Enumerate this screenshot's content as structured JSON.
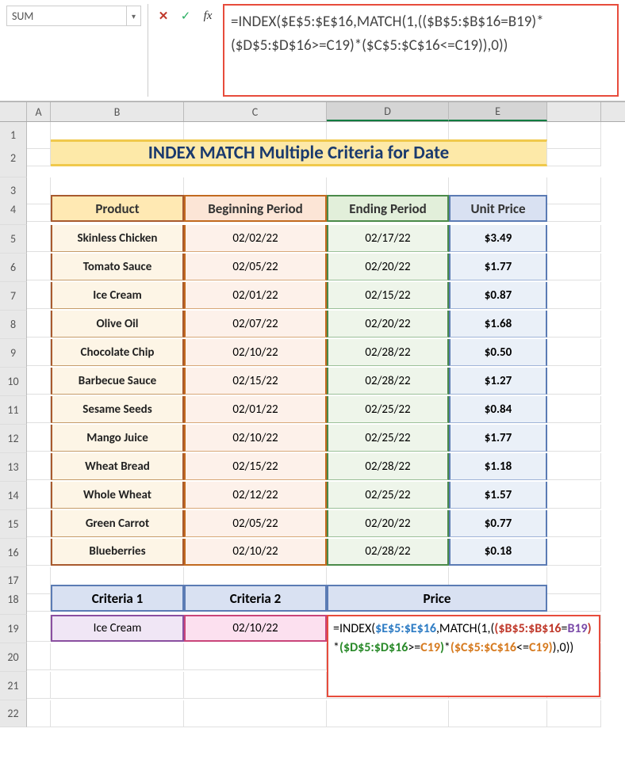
{
  "namebox": "SUM",
  "formula_bar": "=INDEX($E$5:$E$16,MATCH(1,(($B$5:$B$16=B19)*($D$5:$D$16>=C19)*($C$5:$C$16<=C19)),0))",
  "columns": [
    "",
    "A",
    "B",
    "C",
    "D",
    "E",
    ""
  ],
  "title": "INDEX MATCH Multiple Criteria for Date",
  "headers": [
    "Product",
    "Beginning Period",
    "Ending Period",
    "Unit Price"
  ],
  "rows": [
    {
      "product": "Skinless Chicken",
      "begin": "02/02/22",
      "end": "02/17/22",
      "price": "$3.49"
    },
    {
      "product": "Tomato Sauce",
      "begin": "02/05/22",
      "end": "02/20/22",
      "price": "$1.77"
    },
    {
      "product": "Ice Cream",
      "begin": "02/01/22",
      "end": "02/15/22",
      "price": "$0.87"
    },
    {
      "product": "Olive Oil",
      "begin": "02/07/22",
      "end": "02/20/22",
      "price": "$1.68"
    },
    {
      "product": "Chocolate Chip",
      "begin": "02/10/22",
      "end": "02/28/22",
      "price": "$0.50"
    },
    {
      "product": "Barbecue Sauce",
      "begin": "02/15/22",
      "end": "02/28/22",
      "price": "$1.27"
    },
    {
      "product": "Sesame Seeds",
      "begin": "02/01/22",
      "end": "02/25/22",
      "price": "$0.84"
    },
    {
      "product": "Mango Juice",
      "begin": "02/10/22",
      "end": "02/25/22",
      "price": "$1.77"
    },
    {
      "product": "Wheat Bread",
      "begin": "02/15/22",
      "end": "02/28/22",
      "price": "$1.18"
    },
    {
      "product": "Whole Wheat",
      "begin": "02/12/22",
      "end": "02/25/22",
      "price": "$1.57"
    },
    {
      "product": "Green Carrot",
      "begin": "02/05/22",
      "end": "02/20/22",
      "price": "$0.77"
    },
    {
      "product": "Blueberries",
      "begin": "02/10/22",
      "end": "02/28/22",
      "price": "$0.18"
    }
  ],
  "criteria_headers": [
    "Criteria 1",
    "Criteria 2",
    "Price"
  ],
  "criteria_values": {
    "c1": "Ice Cream",
    "c2": "02/10/22"
  },
  "inline_formula_parts": {
    "p1": "=INDEX(",
    "p2": "$E$5:$E$16",
    "p3": ",MATCH(1,(",
    "p4": "(",
    "p5": "$B$5:$B$16",
    "p6": "=",
    "p7": "B19",
    "p8": ")",
    "p9": "*",
    "p10": "(",
    "p11": "$D$5:$D$16",
    "p12": ">=",
    "p13": "C19",
    "p14": ")",
    "p15": "*",
    "p16": "(",
    "p17": "$C$5:$C$16",
    "p18": "<=",
    "p19": "C19",
    "p20": ")",
    "p21": "),0))"
  },
  "row_numbers": [
    "1",
    "2",
    "3",
    "4",
    "5",
    "6",
    "7",
    "8",
    "9",
    "10",
    "11",
    "12",
    "13",
    "14",
    "15",
    "16",
    "17",
    "18",
    "19",
    "20",
    "21",
    "22"
  ]
}
